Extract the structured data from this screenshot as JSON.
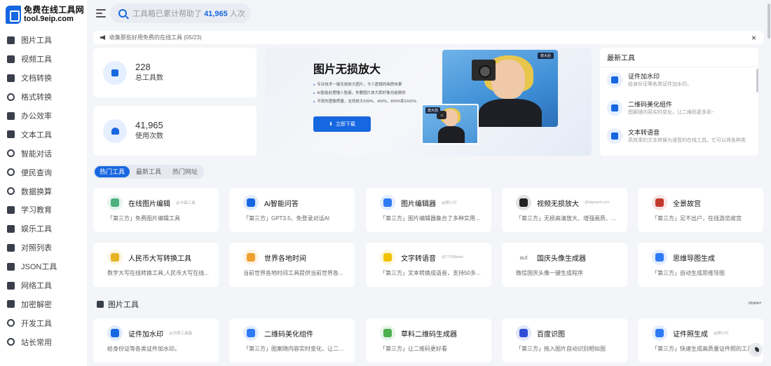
{
  "logo": {
    "title": "免费在线工具网",
    "url": "tool.9eip.com"
  },
  "sidebar": {
    "items": [
      {
        "label": "图片工具",
        "icon": "image-icon"
      },
      {
        "label": "视频工具",
        "icon": "video-icon"
      },
      {
        "label": "文档转换",
        "icon": "document-icon"
      },
      {
        "label": "格式转换",
        "icon": "refresh-icon"
      },
      {
        "label": "办公效率",
        "icon": "robot-icon"
      },
      {
        "label": "文本工具",
        "icon": "book-icon"
      },
      {
        "label": "智能对话",
        "icon": "bulb-icon"
      },
      {
        "label": "便民查询",
        "icon": "search-icon"
      },
      {
        "label": "数据换算",
        "icon": "gear-icon"
      },
      {
        "label": "学习教育",
        "icon": "graduation-icon"
      },
      {
        "label": "娱乐工具",
        "icon": "grid-icon"
      },
      {
        "label": "对照列表",
        "icon": "layers-icon"
      },
      {
        "label": "JSON工具",
        "icon": "list-icon"
      },
      {
        "label": "网络工具",
        "icon": "windows-icon"
      },
      {
        "label": "加密解密",
        "icon": "tag-icon"
      },
      {
        "label": "开发工具",
        "icon": "code-icon"
      },
      {
        "label": "站长常用",
        "icon": "smile-icon"
      }
    ]
  },
  "search": {
    "prefix": "工具箱已累计帮助了",
    "count": "41,965",
    "suffix": "人次"
  },
  "notice": {
    "text": "收集那些好用免费的在线工具 (05/23)",
    "close": "×"
  },
  "stats": [
    {
      "value": "228",
      "label": "总工具数"
    },
    {
      "value": "41,965",
      "label": "使用次数"
    }
  ],
  "banner": {
    "title": "图片无损放大",
    "points": [
      "专业技术一键无损放大图片，令人震撼的画质效果",
      "AI智能处理懂人脸痛，你要图片放大那好像也能做到",
      "不损失图像质量，支持放大200%、400%、800%和1600%"
    ],
    "button": "立即下载",
    "tag_after": "放大后",
    "tag_before": "放大前"
  },
  "latest": {
    "title": "最新工具",
    "items": [
      {
        "name": "证件加水印",
        "desc": "给身份证等各类证件加水印。"
      },
      {
        "name": "二维码美化组件",
        "desc": "图案随内容实时变化，让二维码更多彩~"
      },
      {
        "name": "文本转语音",
        "desc": "高效率的文本转换为语音的在线工具。它可以将各种类"
      }
    ]
  },
  "tabs": [
    {
      "label": "热门工具",
      "active": true
    },
    {
      "label": "最新工具",
      "active": false
    },
    {
      "label": "热门网址",
      "active": false
    }
  ],
  "hot_tools": [
    {
      "name": "在线图片编辑",
      "by": "@卡森工具",
      "desc": "「第三方」免费图片编辑工具",
      "color": "#4caf7d",
      "icon": "landscape-icon"
    },
    {
      "name": "Ai智能问答",
      "by": "",
      "desc": "「第三方」GPT3.5、免登录对话AI",
      "color": "#1767e0",
      "icon": "openai-icon"
    },
    {
      "name": "图片编辑器",
      "by": "@帮小忙",
      "desc": "「第三方」图片编辑器集合了多种实用...",
      "color": "#2f7bf5",
      "icon": "editor-icon"
    },
    {
      "name": "视频无损放大",
      "by": "@bigmp4.com",
      "desc": "「第三方」无损高清放大、增强画质、...",
      "color": "#222222",
      "icon": "bigmp4-icon"
    },
    {
      "name": "全景故宫",
      "by": "",
      "desc": "「第三方」足不出户，在线游览故宫",
      "color": "#c0392b",
      "icon": "palace-icon"
    },
    {
      "name": "人民币大写转换工具",
      "by": "",
      "desc": "数字大写在线转换工具;人民币大写在线...",
      "color": "#e6b422",
      "icon": "coin-icon"
    },
    {
      "name": "世界各地时间",
      "by": "",
      "desc": "当前世界各地时间工具提供当前世界各...",
      "color": "#f0a030",
      "icon": "clock-icon"
    },
    {
      "name": "文字转语音",
      "by": "@TTSMaker",
      "desc": "「第三方」文本转换成语音，支持50多...",
      "color": "#f2c200",
      "icon": "tts-icon"
    },
    {
      "name": "国庆头像生成器",
      "by": "",
      "desc": "微信国庆头像一键生成程序",
      "color": "#bbbbbb",
      "icon": "broken-image-icon",
      "alt": "aut"
    },
    {
      "name": "思维导图生成",
      "by": "",
      "desc": "「第三方」自动生成思维导图",
      "color": "#2f7bf5",
      "icon": "mindmap-icon"
    }
  ],
  "section": {
    "title": "图片工具",
    "more": "more+"
  },
  "image_tools": [
    {
      "name": "证件加水印",
      "by": "@无限工具箱",
      "desc": "给身份证等各类证件加水印。",
      "color": "#1767e0",
      "icon": "watermark-icon"
    },
    {
      "name": "二维码美化组件",
      "by": "",
      "desc": "「第三方」图案随内容实时变化，让二维...",
      "color": "#2f7bf5",
      "icon": "qrcode-icon"
    },
    {
      "name": "草料二维码生成器",
      "by": "",
      "desc": "「第三方」让二维码更好看",
      "color": "#4caf50",
      "icon": "caoliao-icon"
    },
    {
      "name": "百度识图",
      "by": "",
      "desc": "「第三方」拖入图片自动识别相似图",
      "color": "#2f4bd6",
      "icon": "baidu-icon"
    },
    {
      "name": "证件照生成",
      "by": "@帮小忙",
      "desc": "「第三方」快速生成高质量证件照的工具",
      "color": "#2f7bf5",
      "icon": "idphoto-icon"
    }
  ]
}
